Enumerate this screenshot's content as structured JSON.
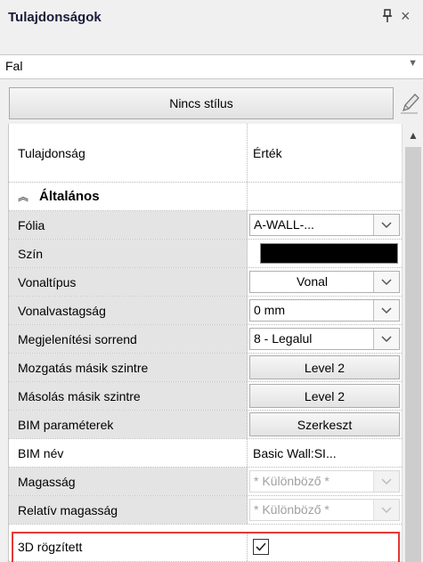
{
  "panel": {
    "title": "Tulajdonságok",
    "close_glyph": "×"
  },
  "object_selector": {
    "value": "Fal"
  },
  "style_button": {
    "label": "Nincs stílus"
  },
  "grid": {
    "col_property": "Tulajdonság",
    "col_value": "Érték",
    "section": "Általános",
    "rows": [
      {
        "name": "Fólia",
        "value": "A-WALL-..."
      },
      {
        "name": "Szín",
        "value_color": "#000000"
      },
      {
        "name": "Vonaltípus",
        "value": "Vonal"
      },
      {
        "name": "Vonalvastagság",
        "value": "0 mm"
      },
      {
        "name": "Megjelenítési sorrend",
        "value": "8 - Legalul"
      },
      {
        "name": "Mozgatás másik szintre",
        "value": "Level 2"
      },
      {
        "name": "Másolás másik szintre",
        "value": "Level 2"
      },
      {
        "name": "BIM paraméterek",
        "value": "Szerkeszt"
      },
      {
        "name": "BIM név",
        "value": "Basic Wall:SI..."
      },
      {
        "name": "Magasság",
        "value": "* Különböző *"
      },
      {
        "name": "Relatív magasság",
        "value": "* Különböző *"
      },
      {
        "name": "3D rögzített",
        "checked": true
      }
    ]
  },
  "colors": {
    "highlight": "#e53935",
    "alt_row": "#e4e4e4"
  }
}
